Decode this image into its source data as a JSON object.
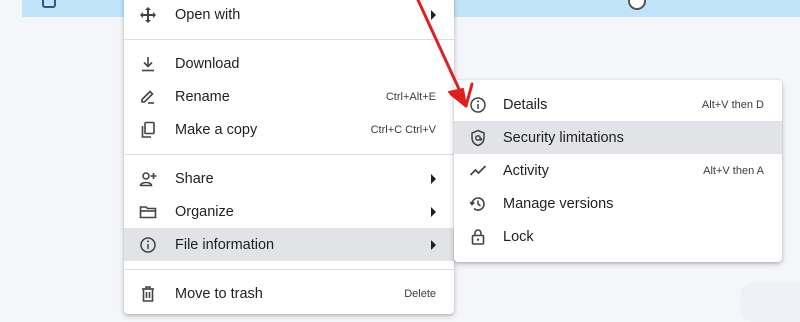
{
  "menu": {
    "items": [
      {
        "label": "Open with",
        "icon": "move-arrows-icon"
      },
      {
        "label": "Download",
        "icon": "download-icon"
      },
      {
        "label": "Rename",
        "shortcut": "Ctrl+Alt+E",
        "icon": "pencil-icon"
      },
      {
        "label": "Make a copy",
        "shortcut": "Ctrl+C Ctrl+V",
        "icon": "copy-icon"
      },
      {
        "label": "Share",
        "icon": "person-add-icon"
      },
      {
        "label": "Organize",
        "icon": "folder-icon"
      },
      {
        "label": "File information",
        "icon": "info-icon"
      },
      {
        "label": "Move to trash",
        "shortcut": "Delete",
        "icon": "trash-icon"
      }
    ]
  },
  "submenu": {
    "items": [
      {
        "label": "Details",
        "shortcut": "Alt+V then D",
        "icon": "info-icon"
      },
      {
        "label": "Security limitations",
        "icon": "shield-icon"
      },
      {
        "label": "Activity",
        "shortcut": "Alt+V then A",
        "icon": "activity-icon"
      },
      {
        "label": "Manage versions",
        "icon": "history-icon"
      },
      {
        "label": "Lock",
        "icon": "lock-icon"
      }
    ]
  },
  "colors": {
    "highlight": "#e1e3e6",
    "top_band": "#c2e4fb",
    "annotation_arrow": "#e02020"
  }
}
